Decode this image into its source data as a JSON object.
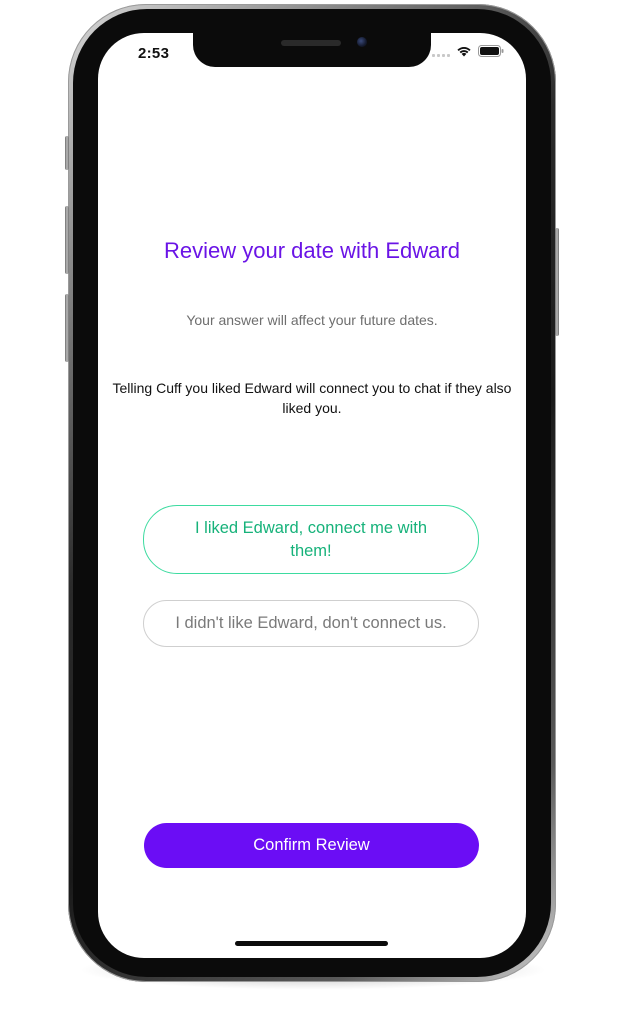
{
  "status_bar": {
    "time": "2:53",
    "signal_icon": "cellular-signal-icon",
    "wifi_icon": "wifi-icon",
    "battery_icon": "battery-icon"
  },
  "review": {
    "title": "Review your date with Edward",
    "subtitle": "Your answer will affect your future dates.",
    "description": "Telling Cuff you liked Edward will connect you to chat if they also liked you."
  },
  "choices": {
    "like_label": "I liked Edward, connect me with them!",
    "dislike_label": "I didn't like Edward, don't connect us."
  },
  "actions": {
    "confirm_label": "Confirm Review"
  },
  "colors": {
    "accent": "#6b0df5",
    "title": "#6a14e6",
    "like": "#16b27a",
    "like_border": "#3ddba0",
    "dislike_border": "#cfcfcf"
  }
}
